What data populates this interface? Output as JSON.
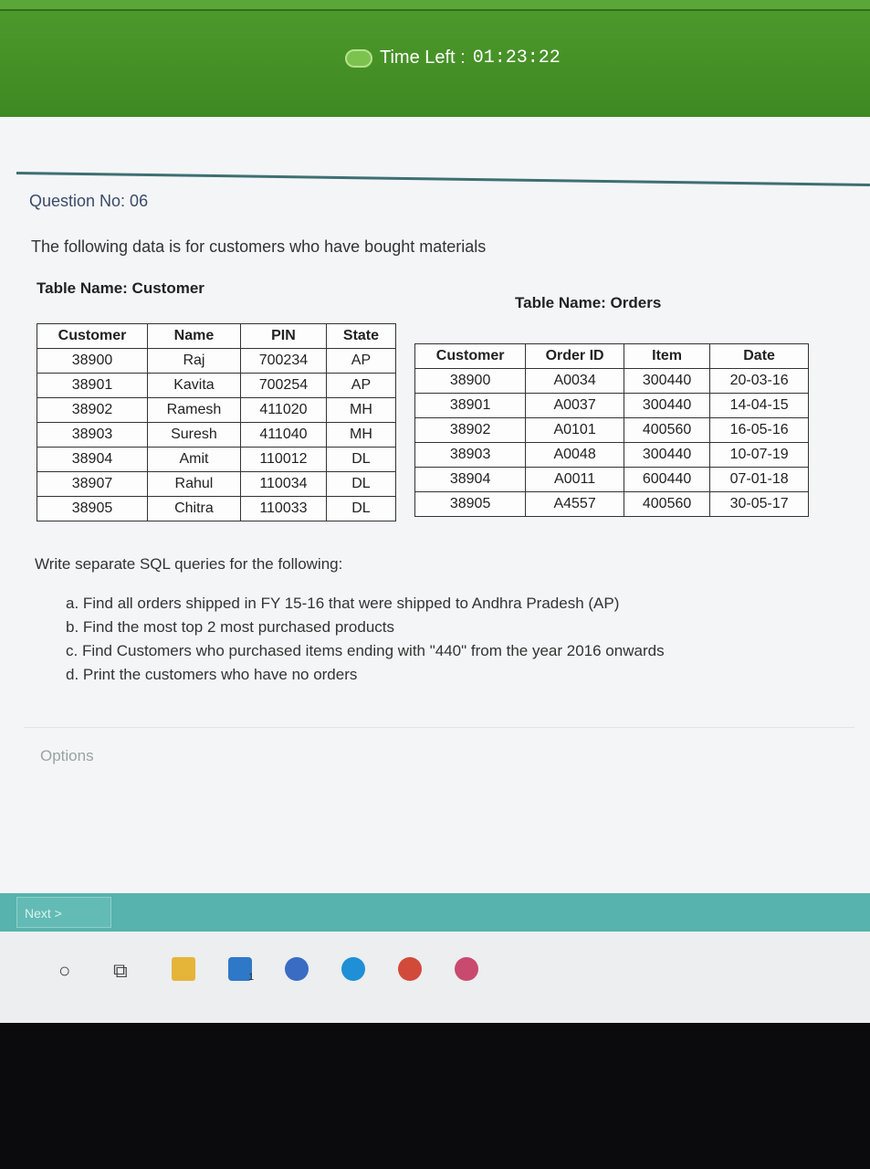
{
  "header": {
    "timer_label": "Time Left :",
    "timer_value": "01:23:22"
  },
  "question": {
    "number_label": "Question No: 06",
    "intro": "The following data is for customers who have bought materials",
    "prompt": "Write separate SQL queries for the following:",
    "items": [
      "a. Find all orders shipped in FY 15-16 that were shipped to Andhra Pradesh (AP)",
      "b. Find the most top 2 most purchased products",
      "c. Find Customers who purchased items ending with \"440\" from the year 2016 onwards",
      "d. Print the customers who have no orders"
    ]
  },
  "customer_table": {
    "name_label": "Table Name: Customer",
    "headers": [
      "Customer",
      "Name",
      "PIN",
      "State"
    ],
    "rows": [
      [
        "38900",
        "Raj",
        "700234",
        "AP"
      ],
      [
        "38901",
        "Kavita",
        "700254",
        "AP"
      ],
      [
        "38902",
        "Ramesh",
        "411020",
        "MH"
      ],
      [
        "38903",
        "Suresh",
        "411040",
        "MH"
      ],
      [
        "38904",
        "Amit",
        "110012",
        "DL"
      ],
      [
        "38907",
        "Rahul",
        "110034",
        "DL"
      ],
      [
        "38905",
        "Chitra",
        "110033",
        "DL"
      ]
    ]
  },
  "orders_table": {
    "name_label": "Table Name: Orders",
    "headers": [
      "Customer",
      "Order ID",
      "Item",
      "Date"
    ],
    "rows": [
      [
        "38900",
        "A0034",
        "300440",
        "20-03-16"
      ],
      [
        "38901",
        "A0037",
        "300440",
        "14-04-15"
      ],
      [
        "38902",
        "A0101",
        "400560",
        "16-05-16"
      ],
      [
        "38903",
        "A0048",
        "300440",
        "10-07-19"
      ],
      [
        "38904",
        "A0011",
        "600440",
        "07-01-18"
      ],
      [
        "38905",
        "A4557",
        "400560",
        "30-05-17"
      ]
    ]
  },
  "footer": {
    "options_label": "Options",
    "next_label": "Next >"
  },
  "taskbar": {
    "mail_badge": "1"
  },
  "colors": {
    "header_green": "#3e8a22",
    "nav_teal": "#57b3ad"
  }
}
